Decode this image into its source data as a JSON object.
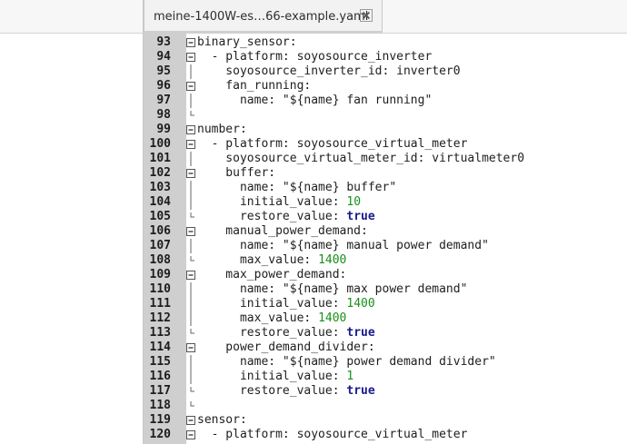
{
  "tab": {
    "title": "meine-1400W-es…66-example.yaml",
    "close_icon": "close-icon"
  },
  "lines": [
    {
      "n": "93",
      "fold": "minus",
      "parts": [
        {
          "t": "binary_sensor:",
          "c": "plain"
        }
      ]
    },
    {
      "n": "94",
      "fold": "minus",
      "parts": [
        {
          "t": "  - platform: soyosource_inverter",
          "c": "plain"
        }
      ]
    },
    {
      "n": "95",
      "fold": "",
      "parts": [
        {
          "t": "    soyosource_inverter_id: inverter0",
          "c": "plain"
        }
      ]
    },
    {
      "n": "96",
      "fold": "minus",
      "parts": [
        {
          "t": "    fan_running:",
          "c": "plain"
        }
      ]
    },
    {
      "n": "97",
      "fold": "",
      "parts": [
        {
          "t": "      name: \"${name} fan running\"",
          "c": "plain"
        }
      ]
    },
    {
      "n": "98",
      "fold": "end",
      "parts": [
        {
          "t": "",
          "c": "plain"
        }
      ]
    },
    {
      "n": "99",
      "fold": "minus",
      "parts": [
        {
          "t": "number:",
          "c": "plain"
        }
      ]
    },
    {
      "n": "100",
      "fold": "minus",
      "parts": [
        {
          "t": "  - platform: soyosource_virtual_meter",
          "c": "plain"
        }
      ]
    },
    {
      "n": "101",
      "fold": "",
      "parts": [
        {
          "t": "    soyosource_virtual_meter_id: virtualmeter0",
          "c": "plain"
        }
      ]
    },
    {
      "n": "102",
      "fold": "minus",
      "parts": [
        {
          "t": "    buffer:",
          "c": "plain"
        }
      ]
    },
    {
      "n": "103",
      "fold": "",
      "parts": [
        {
          "t": "      name: \"${name} buffer\"",
          "c": "plain"
        }
      ]
    },
    {
      "n": "104",
      "fold": "",
      "parts": [
        {
          "t": "      initial_value: ",
          "c": "plain"
        },
        {
          "t": "10",
          "c": "num"
        }
      ]
    },
    {
      "n": "105",
      "fold": "end",
      "parts": [
        {
          "t": "      restore_value: ",
          "c": "plain"
        },
        {
          "t": "true",
          "c": "bool"
        }
      ]
    },
    {
      "n": "106",
      "fold": "minus",
      "parts": [
        {
          "t": "    manual_power_demand:",
          "c": "plain"
        }
      ]
    },
    {
      "n": "107",
      "fold": "",
      "parts": [
        {
          "t": "      name: \"${name} manual power demand\"",
          "c": "plain"
        }
      ]
    },
    {
      "n": "108",
      "fold": "end",
      "parts": [
        {
          "t": "      max_value: ",
          "c": "plain"
        },
        {
          "t": "1400",
          "c": "num"
        }
      ]
    },
    {
      "n": "109",
      "fold": "minus",
      "parts": [
        {
          "t": "    max_power_demand:",
          "c": "plain"
        }
      ]
    },
    {
      "n": "110",
      "fold": "",
      "parts": [
        {
          "t": "      name: \"${name} max power demand\"",
          "c": "plain"
        }
      ]
    },
    {
      "n": "111",
      "fold": "",
      "parts": [
        {
          "t": "      initial_value: ",
          "c": "plain"
        },
        {
          "t": "1400",
          "c": "num"
        }
      ]
    },
    {
      "n": "112",
      "fold": "",
      "parts": [
        {
          "t": "      max_value: ",
          "c": "plain"
        },
        {
          "t": "1400",
          "c": "num"
        }
      ]
    },
    {
      "n": "113",
      "fold": "end",
      "parts": [
        {
          "t": "      restore_value: ",
          "c": "plain"
        },
        {
          "t": "true",
          "c": "bool"
        }
      ]
    },
    {
      "n": "114",
      "fold": "minus",
      "parts": [
        {
          "t": "    power_demand_divider:",
          "c": "plain"
        }
      ]
    },
    {
      "n": "115",
      "fold": "",
      "parts": [
        {
          "t": "      name: \"${name} power demand divider\"",
          "c": "plain"
        }
      ]
    },
    {
      "n": "116",
      "fold": "",
      "parts": [
        {
          "t": "      initial_value: ",
          "c": "plain"
        },
        {
          "t": "1",
          "c": "num"
        }
      ]
    },
    {
      "n": "117",
      "fold": "end",
      "parts": [
        {
          "t": "      restore_value: ",
          "c": "plain"
        },
        {
          "t": "true",
          "c": "bool"
        }
      ]
    },
    {
      "n": "118",
      "fold": "end",
      "parts": [
        {
          "t": "",
          "c": "plain"
        }
      ]
    },
    {
      "n": "119",
      "fold": "minus",
      "parts": [
        {
          "t": "sensor:",
          "c": "plain"
        }
      ]
    },
    {
      "n": "120",
      "fold": "minus",
      "parts": [
        {
          "t": "  - platform: soyosource_virtual_meter",
          "c": "plain"
        }
      ]
    }
  ],
  "colors": {
    "number": "#1a8f1a",
    "boolean": "#1a1a8c",
    "gutter": "#cfcfcf"
  }
}
